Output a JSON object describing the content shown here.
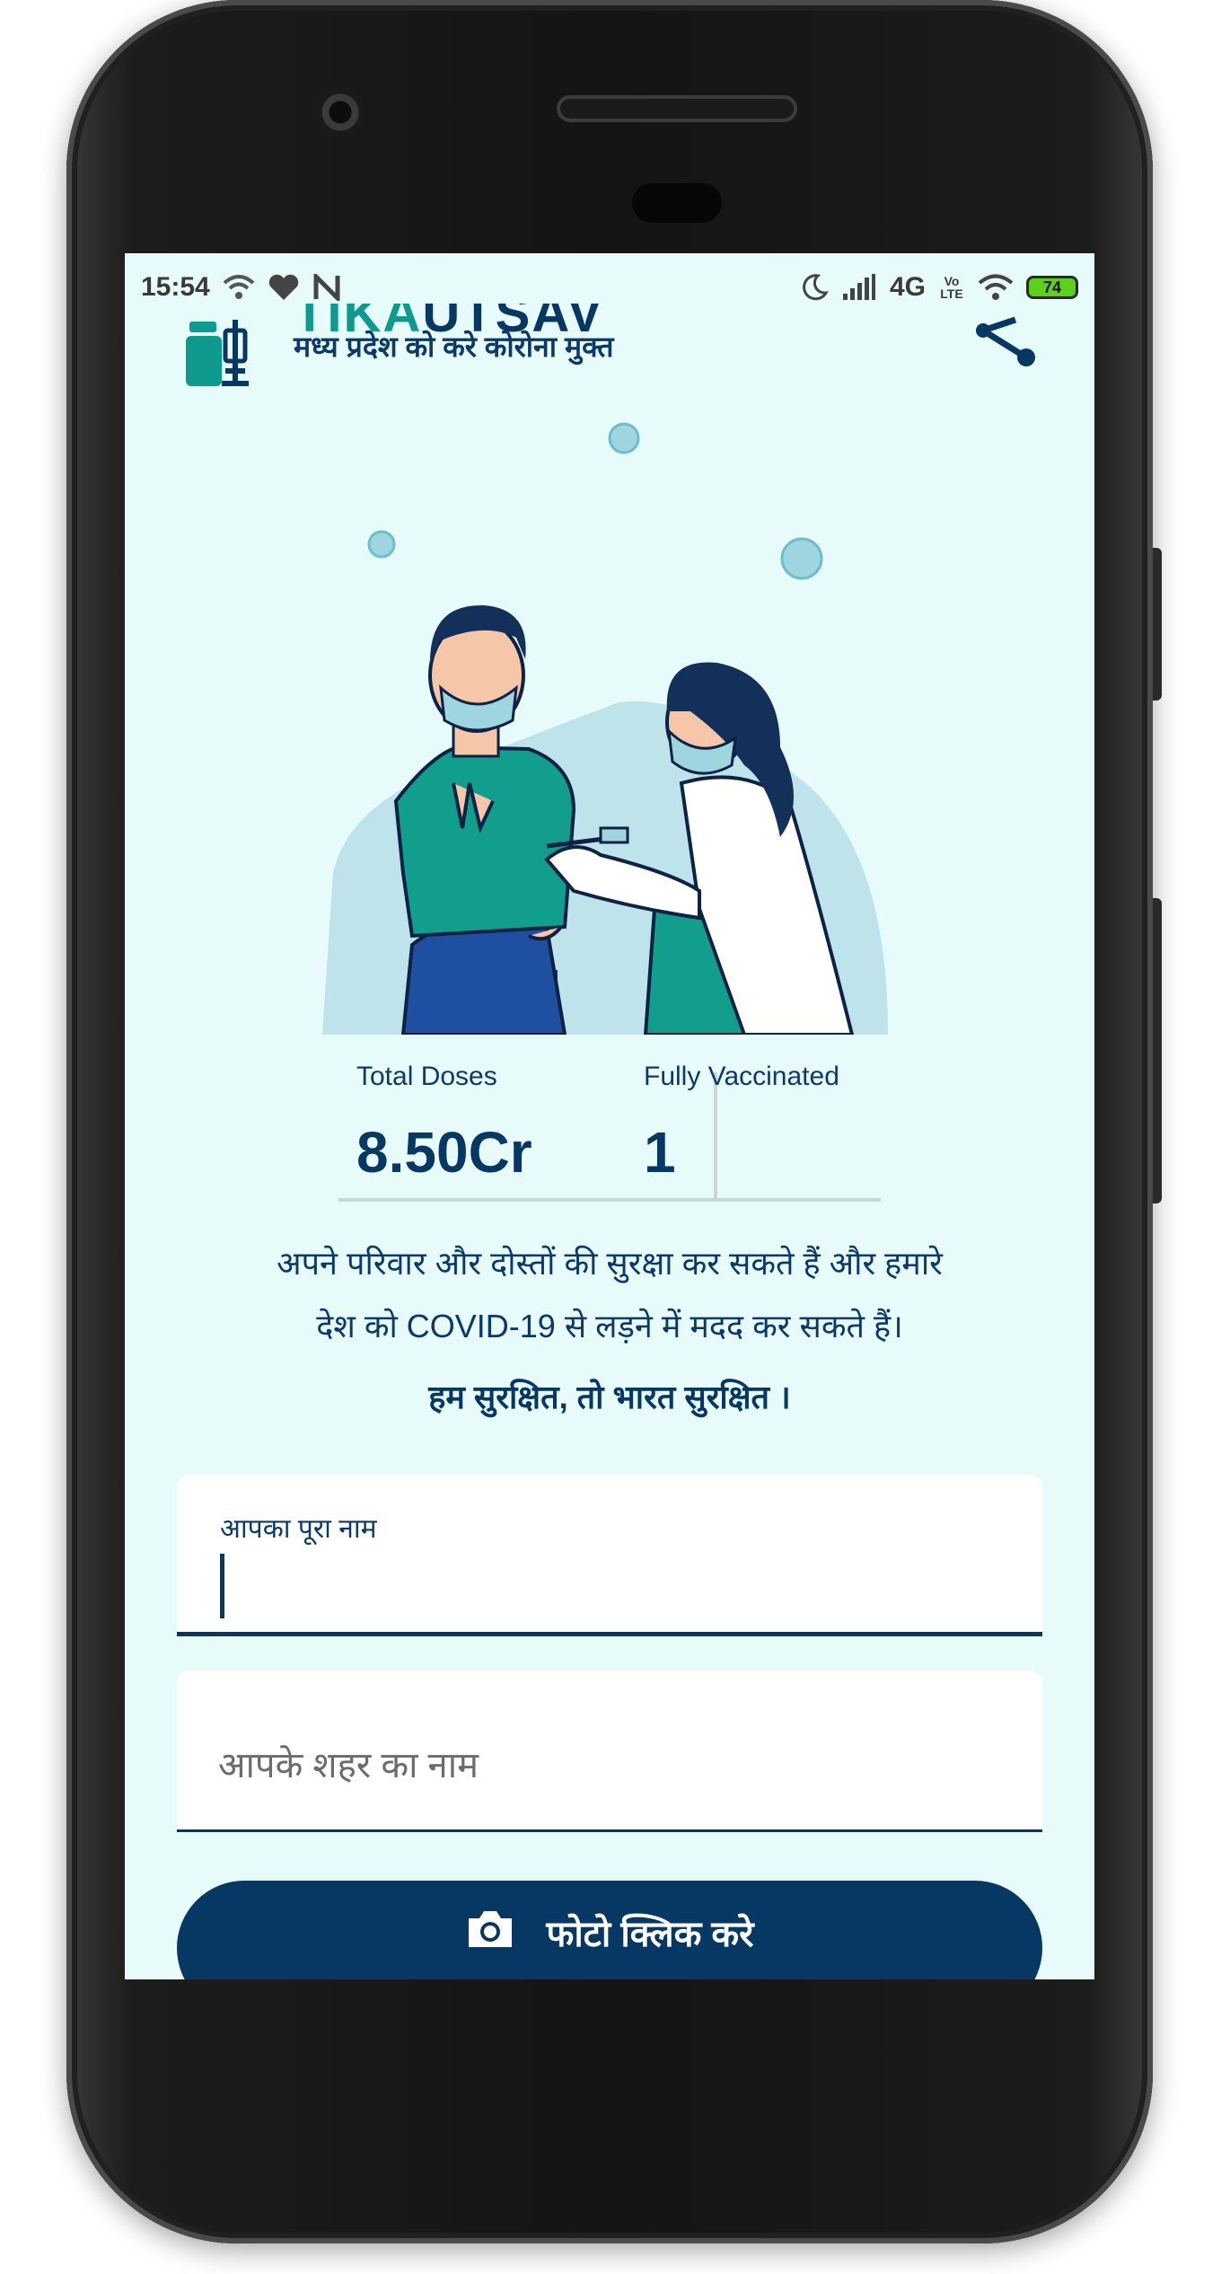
{
  "status_bar": {
    "time": "15:54",
    "network": "4G",
    "volte": "Vo LTE",
    "battery": "74"
  },
  "header": {
    "title_part1": "TIKA",
    "title_part2": "UTSAV",
    "tagline": "मध्य प्रदेश को करे कोरोना मुक्त"
  },
  "stats": {
    "total_doses_label": "Total Doses",
    "total_doses_value": "8.50Cr",
    "fully_vaccinated_label": "Fully Vaccinated",
    "fully_vaccinated_value": "1"
  },
  "message": {
    "line1": "अपने परिवार और दोस्तों की सुरक्षा कर सकते हैं और हमारे",
    "line2": "देश को COVID-19 से लड़ने में मदद कर सकते हैं।",
    "slogan": "हम सुरक्षित, तो भारत सुरक्षित ।"
  },
  "form": {
    "name_label": "आपका पूरा नाम",
    "name_value": "",
    "city_placeholder": "आपके शहर का नाम",
    "city_value": ""
  },
  "photo_button": {
    "label": "फोटो क्लिक करे"
  },
  "icons": [
    "wifi-icon",
    "heart-icon",
    "n-app-icon",
    "moon-icon",
    "signal-icon",
    "battery-icon",
    "vaccine-logo-icon",
    "share-icon",
    "camera-icon",
    "virus-icon"
  ]
}
